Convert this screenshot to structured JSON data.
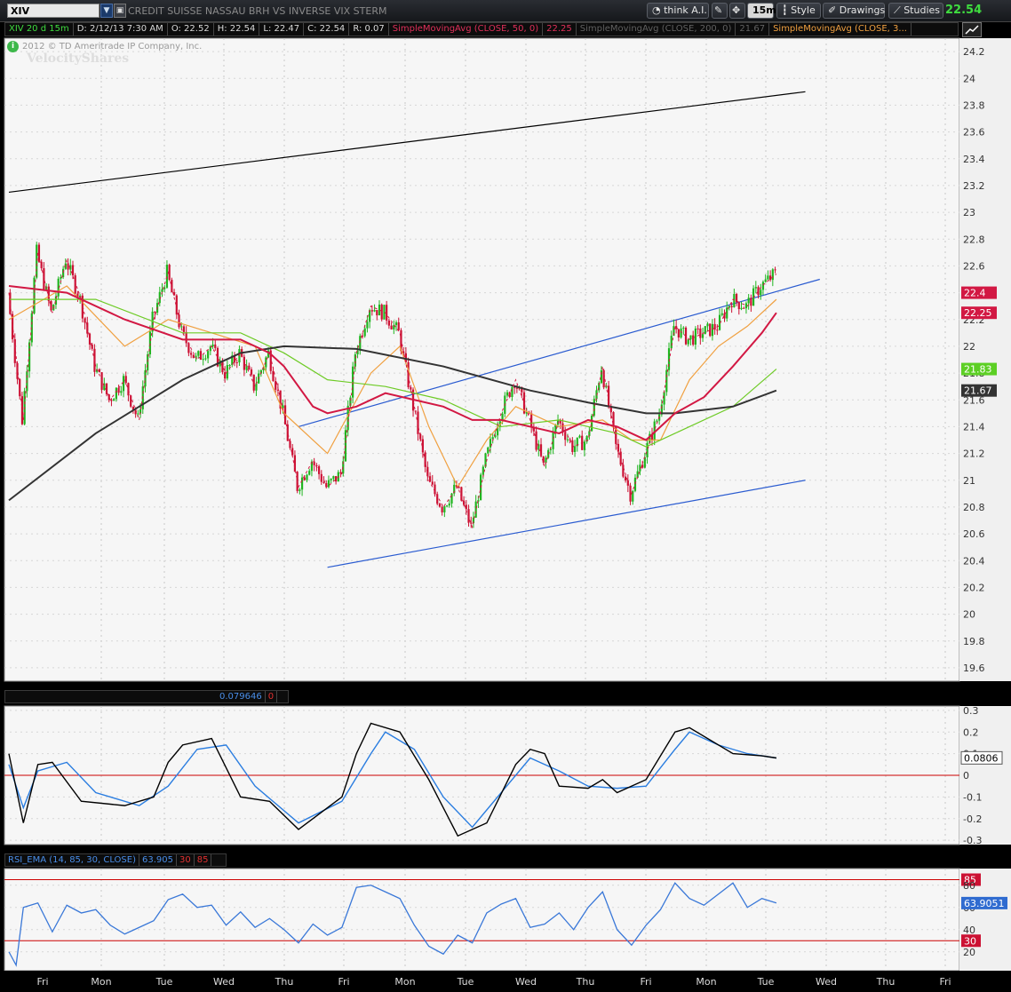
{
  "toolbar": {
    "symbol": "XIV",
    "description": "CREDIT SUISSE NASSAU BRH VS INVERSE VIX STERM",
    "think_label": "think A.I.",
    "interval_label": "15m",
    "style_label": "Style",
    "drawings_label": "Drawings",
    "studies_label": "Studies",
    "last_price": "22.54"
  },
  "infobar": {
    "symbol_period": "XIV 20 d 15m",
    "date": "D: 2/12/13 7:30 AM",
    "open": "O: 22.52",
    "high": "H: 22.54",
    "low": "L: 22.47",
    "close": "C: 22.54",
    "range": "R: 0.07",
    "sma50": "SimpleMovingAvg (CLOSE, 50, 0)",
    "sma50_val": "22.25",
    "sma200": "SimpleMovingAvg (CLOSE, 200, 0)",
    "sma200_val": "21.67",
    "sma3": "SimpleMovingAvg (CLOSE, 3..."
  },
  "watermark": {
    "copyright": "2012 © TD Ameritrade IP Company, Inc.",
    "brand": "VelocityShares"
  },
  "colors": {
    "up": "#1fb51f",
    "down": "#cc1133",
    "sma50": "#d21843",
    "sma200": "#333333",
    "sma_green": "#6ecb26",
    "sma_orange": "#f0a040",
    "channel": "#2a5bd0",
    "rsi": "#3a78d8",
    "osc_fast": "#000000",
    "osc_slow": "#2a7de0"
  },
  "chart_data": [
    {
      "type": "candlestick",
      "ylim": [
        19.5,
        24.3
      ],
      "yticks": [
        19.6,
        19.8,
        20,
        20.2,
        20.4,
        20.6,
        20.8,
        21,
        21.2,
        21.4,
        21.6,
        21.8,
        22,
        22.2,
        22.4,
        22.6,
        22.8,
        23,
        23.2,
        23.4,
        23.6,
        23.8,
        24,
        24.2
      ],
      "day_labels": [
        "Fri",
        "Mon",
        "Tue",
        "Wed",
        "Thu",
        "Fri",
        "Mon",
        "Tue",
        "Wed",
        "Thu",
        "Fri",
        "Mon",
        "Tue",
        "Wed",
        "Thu",
        "Fri"
      ],
      "price_labels": [
        {
          "value": 22.4,
          "text": "22.4",
          "color": "#d21843"
        },
        {
          "value": 22.25,
          "text": "22.25",
          "color": "#d21843"
        },
        {
          "value": 21.83,
          "text": "21.83",
          "color": "#5ccf24"
        },
        {
          "value": 21.67,
          "text": "21.67",
          "color": "#333333"
        }
      ],
      "path_points": [
        [
          0,
          22.4
        ],
        [
          1,
          21.45
        ],
        [
          2,
          22.7
        ],
        [
          3,
          22.25
        ],
        [
          4,
          22.65
        ],
        [
          5,
          22.35
        ],
        [
          6,
          21.85
        ],
        [
          7,
          21.6
        ],
        [
          8,
          21.75
        ],
        [
          9,
          21.45
        ],
        [
          10,
          22.2
        ],
        [
          11,
          22.55
        ],
        [
          12,
          22.1
        ],
        [
          13,
          21.9
        ],
        [
          14,
          22.0
        ],
        [
          15,
          21.8
        ],
        [
          16,
          21.95
        ],
        [
          17,
          21.7
        ],
        [
          18,
          21.95
        ],
        [
          19,
          21.5
        ],
        [
          20,
          20.95
        ],
        [
          21,
          21.15
        ],
        [
          22,
          20.95
        ],
        [
          23,
          21.05
        ],
        [
          24,
          21.95
        ],
        [
          25,
          22.3
        ],
        [
          26,
          22.25
        ],
        [
          27,
          22.1
        ],
        [
          28,
          21.55
        ],
        [
          29,
          21.0
        ],
        [
          30,
          20.8
        ],
        [
          31,
          20.95
        ],
        [
          32,
          20.65
        ],
        [
          33,
          21.15
        ],
        [
          34,
          21.5
        ],
        [
          35,
          21.75
        ],
        [
          36,
          21.45
        ],
        [
          37,
          21.1
        ],
        [
          38,
          21.45
        ],
        [
          39,
          21.25
        ],
        [
          40,
          21.3
        ],
        [
          41,
          21.85
        ],
        [
          42,
          21.25
        ],
        [
          43,
          20.9
        ],
        [
          44,
          21.2
        ],
        [
          45,
          21.5
        ],
        [
          46,
          22.15
        ],
        [
          47,
          22.05
        ],
        [
          48,
          22.1
        ],
        [
          49,
          22.15
        ],
        [
          50,
          22.35
        ],
        [
          51,
          22.3
        ],
        [
          52,
          22.45
        ],
        [
          53,
          22.54
        ]
      ],
      "sma50": [
        [
          0,
          22.45
        ],
        [
          4,
          22.4
        ],
        [
          8,
          22.2
        ],
        [
          12,
          22.05
        ],
        [
          16,
          22.05
        ],
        [
          18,
          21.95
        ],
        [
          19,
          21.85
        ],
        [
          21,
          21.55
        ],
        [
          22,
          21.5
        ],
        [
          24,
          21.55
        ],
        [
          26,
          21.65
        ],
        [
          28,
          21.6
        ],
        [
          30,
          21.55
        ],
        [
          32,
          21.45
        ],
        [
          34,
          21.45
        ],
        [
          36,
          21.4
        ],
        [
          38,
          21.35
        ],
        [
          40,
          21.45
        ],
        [
          42,
          21.4
        ],
        [
          44,
          21.3
        ],
        [
          46,
          21.5
        ],
        [
          48,
          21.62
        ],
        [
          50,
          21.85
        ],
        [
          52,
          22.1
        ],
        [
          53,
          22.25
        ]
      ],
      "sma200": [
        [
          0,
          20.85
        ],
        [
          6,
          21.35
        ],
        [
          12,
          21.75
        ],
        [
          16,
          21.95
        ],
        [
          19,
          22.0
        ],
        [
          24,
          21.98
        ],
        [
          30,
          21.85
        ],
        [
          36,
          21.67
        ],
        [
          40,
          21.58
        ],
        [
          44,
          21.5
        ],
        [
          46,
          21.5
        ],
        [
          50,
          21.55
        ],
        [
          53,
          21.67
        ]
      ],
      "sma_green": [
        [
          0,
          22.35
        ],
        [
          6,
          22.35
        ],
        [
          12,
          22.1
        ],
        [
          16,
          22.1
        ],
        [
          19,
          21.95
        ],
        [
          22,
          21.75
        ],
        [
          26,
          21.7
        ],
        [
          30,
          21.6
        ],
        [
          34,
          21.4
        ],
        [
          38,
          21.45
        ],
        [
          42,
          21.35
        ],
        [
          44,
          21.25
        ],
        [
          46,
          21.35
        ],
        [
          50,
          21.55
        ],
        [
          53,
          21.83
        ]
      ],
      "sma_orange": [
        [
          0,
          22.2
        ],
        [
          4,
          22.45
        ],
        [
          8,
          22.0
        ],
        [
          11,
          22.2
        ],
        [
          14,
          22.1
        ],
        [
          17,
          22.0
        ],
        [
          19,
          21.5
        ],
        [
          22,
          21.2
        ],
        [
          25,
          21.8
        ],
        [
          27,
          22.0
        ],
        [
          29,
          21.4
        ],
        [
          31,
          20.95
        ],
        [
          33,
          21.3
        ],
        [
          35,
          21.55
        ],
        [
          38,
          21.4
        ],
        [
          41,
          21.45
        ],
        [
          43,
          21.3
        ],
        [
          45,
          21.3
        ],
        [
          47,
          21.75
        ],
        [
          49,
          22.0
        ],
        [
          51,
          22.15
        ],
        [
          53,
          22.35
        ]
      ],
      "trend_lines": [
        {
          "from": [
            0,
            23.15
          ],
          "to": [
            55,
            23.9
          ],
          "color": "#000000"
        },
        {
          "from": [
            20,
            21.4
          ],
          "to": [
            56,
            22.5
          ],
          "color": "#2a5bd0"
        },
        {
          "from": [
            22,
            20.35
          ],
          "to": [
            55,
            21.0
          ],
          "color": "#2a5bd0"
        }
      ]
    },
    {
      "type": "line",
      "label_value": "0.079646",
      "label_zero": "0",
      "ylim": [
        -0.32,
        0.32
      ],
      "yticks": [
        -0.3,
        -0.2,
        -0.1,
        0,
        0.1,
        0.2,
        0.3
      ],
      "current_label": "0.0806",
      "zero_line_color": "#cc0000",
      "fast": [
        [
          0,
          0.1
        ],
        [
          1,
          -0.22
        ],
        [
          2,
          0.05
        ],
        [
          3,
          0.06
        ],
        [
          5,
          -0.12
        ],
        [
          8,
          -0.14
        ],
        [
          10,
          -0.1
        ],
        [
          11,
          0.06
        ],
        [
          12,
          0.14
        ],
        [
          14,
          0.17
        ],
        [
          16,
          -0.1
        ],
        [
          18,
          -0.12
        ],
        [
          20,
          -0.25
        ],
        [
          23,
          -0.1
        ],
        [
          24,
          0.1
        ],
        [
          25,
          0.24
        ],
        [
          27,
          0.2
        ],
        [
          29,
          -0.02
        ],
        [
          31,
          -0.28
        ],
        [
          33,
          -0.22
        ],
        [
          35,
          0.05
        ],
        [
          36,
          0.12
        ],
        [
          37,
          0.1
        ],
        [
          38,
          -0.05
        ],
        [
          40,
          -0.06
        ],
        [
          41,
          -0.02
        ],
        [
          42,
          -0.08
        ],
        [
          44,
          -0.02
        ],
        [
          46,
          0.2
        ],
        [
          47,
          0.22
        ],
        [
          50,
          0.1
        ],
        [
          52,
          0.09
        ],
        [
          53,
          0.08
        ]
      ],
      "slow": [
        [
          0,
          0.05
        ],
        [
          1,
          -0.15
        ],
        [
          2,
          0.02
        ],
        [
          4,
          0.06
        ],
        [
          6,
          -0.08
        ],
        [
          9,
          -0.14
        ],
        [
          11,
          -0.05
        ],
        [
          13,
          0.12
        ],
        [
          15,
          0.14
        ],
        [
          17,
          -0.05
        ],
        [
          20,
          -0.22
        ],
        [
          23,
          -0.12
        ],
        [
          25,
          0.1
        ],
        [
          26,
          0.2
        ],
        [
          28,
          0.12
        ],
        [
          30,
          -0.1
        ],
        [
          32,
          -0.24
        ],
        [
          34,
          -0.08
        ],
        [
          36,
          0.08
        ],
        [
          38,
          0.02
        ],
        [
          40,
          -0.05
        ],
        [
          42,
          -0.06
        ],
        [
          44,
          -0.05
        ],
        [
          46,
          0.12
        ],
        [
          47,
          0.2
        ],
        [
          49,
          0.14
        ],
        [
          51,
          0.1
        ],
        [
          53,
          0.08
        ]
      ]
    },
    {
      "type": "line",
      "name": "RSI_EMA (14, 85, 30, CLOSE)",
      "value": "63.905",
      "low_level": "30",
      "high_level": "85",
      "ylim": [
        3,
        95
      ],
      "yticks": [
        20,
        40,
        60,
        80
      ],
      "current_label": "63.9051",
      "levels": [
        {
          "value": 85,
          "text": "85"
        },
        {
          "value": 30,
          "text": "30"
        }
      ],
      "rsi": [
        [
          0,
          20
        ],
        [
          0.5,
          8
        ],
        [
          1,
          60
        ],
        [
          2,
          64
        ],
        [
          3,
          38
        ],
        [
          4,
          62
        ],
        [
          5,
          55
        ],
        [
          6,
          58
        ],
        [
          7,
          44
        ],
        [
          8,
          36
        ],
        [
          9,
          42
        ],
        [
          10,
          48
        ],
        [
          11,
          67
        ],
        [
          12,
          72
        ],
        [
          13,
          60
        ],
        [
          14,
          62
        ],
        [
          15,
          44
        ],
        [
          16,
          56
        ],
        [
          17,
          42
        ],
        [
          18,
          50
        ],
        [
          19,
          40
        ],
        [
          20,
          28
        ],
        [
          21,
          45
        ],
        [
          22,
          35
        ],
        [
          23,
          42
        ],
        [
          24,
          78
        ],
        [
          25,
          80
        ],
        [
          26,
          74
        ],
        [
          27,
          68
        ],
        [
          28,
          44
        ],
        [
          29,
          25
        ],
        [
          30,
          18
        ],
        [
          31,
          35
        ],
        [
          32,
          28
        ],
        [
          33,
          55
        ],
        [
          34,
          63
        ],
        [
          35,
          68
        ],
        [
          36,
          42
        ],
        [
          37,
          45
        ],
        [
          38,
          55
        ],
        [
          39,
          40
        ],
        [
          40,
          60
        ],
        [
          41,
          74
        ],
        [
          42,
          40
        ],
        [
          43,
          26
        ],
        [
          44,
          44
        ],
        [
          45,
          58
        ],
        [
          46,
          82
        ],
        [
          47,
          68
        ],
        [
          48,
          62
        ],
        [
          49,
          72
        ],
        [
          50,
          82
        ],
        [
          51,
          60
        ],
        [
          52,
          68
        ],
        [
          53,
          64
        ]
      ]
    }
  ]
}
